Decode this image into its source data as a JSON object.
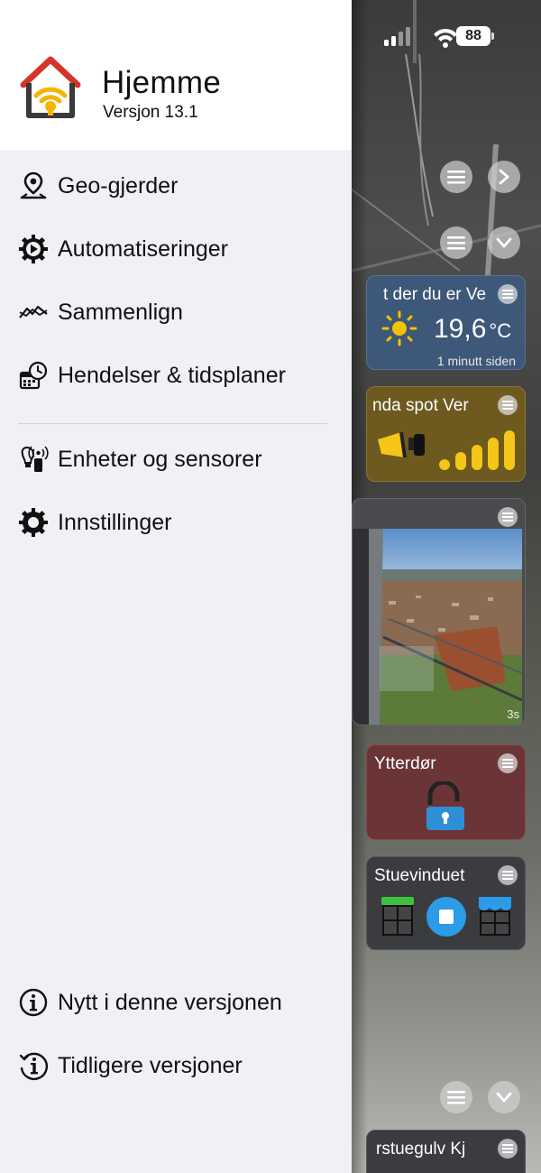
{
  "status_bar": {
    "battery": "88"
  },
  "drawer": {
    "app_name": "Hjemme",
    "version": "Versjon 13.1",
    "menu_items": [
      {
        "label": "Geo-gjerder",
        "icon": "location-pin-icon"
      },
      {
        "label": "Automatiseringer",
        "icon": "play-gear-icon"
      },
      {
        "label": "Sammenlign",
        "icon": "compare-graph-icon"
      },
      {
        "label": "Hendelser & tidsplaner",
        "icon": "calendar-clock-icon"
      },
      {
        "label": "Enheter og sensorer",
        "icon": "devices-sensors-icon"
      },
      {
        "label": "Innstillinger",
        "icon": "gear-icon"
      }
    ],
    "footer_items": [
      {
        "label": "Nytt i denne versjonen",
        "icon": "info-icon"
      },
      {
        "label": "Tidligere versjoner",
        "icon": "history-info-icon"
      }
    ]
  },
  "tiles": {
    "weather": {
      "title": "t der du er  Ve",
      "temperature": "19,6",
      "unit": "°C",
      "updated": "1 minutt siden",
      "color": "#3d5878"
    },
    "spot": {
      "title": "nda spot  Ver",
      "color": "#6e5a1e",
      "accent": "#f5c518"
    },
    "camera": {
      "badge": "3s"
    },
    "door": {
      "title": "Ytterdør",
      "color": "#6b3538",
      "lock_color": "#2f8fd6"
    },
    "window": {
      "title": "Stuevinduet",
      "color": "#3a3c40",
      "stop_color": "#2c9be8"
    },
    "floor": {
      "title": "rstuegulv  Kj"
    }
  }
}
